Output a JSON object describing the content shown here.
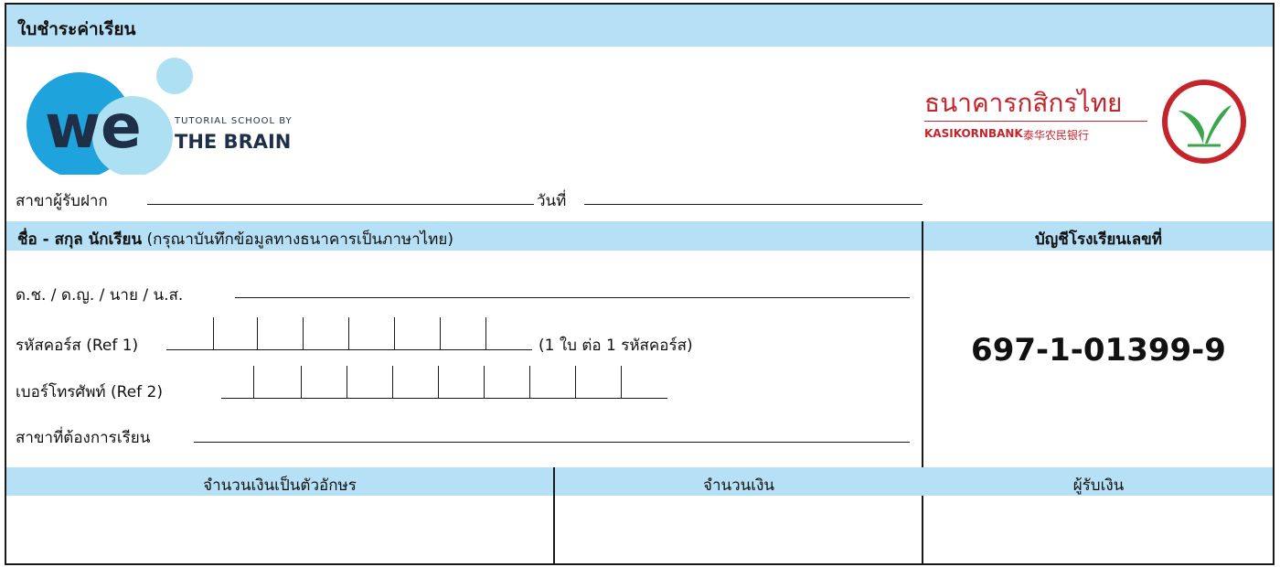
{
  "title": "ใบชำระค่าเรียน",
  "school_logo": {
    "mark": "we",
    "line1": "TUTORIAL SCHOOL BY",
    "line2": "THE BRAIN",
    "colors": {
      "circle_dark": "#1fa3dc",
      "circle_light": "#aee0f4",
      "text_dark": "#1f2f47"
    }
  },
  "bank_logo": {
    "name_thai": "ธนาคารกสิกรไทย",
    "name_en": "KASIKORNBANK",
    "name_cn": "泰华农民银行",
    "colors": {
      "red": "#c5242b",
      "green": "#3aa54a"
    }
  },
  "branch_label": "สาขาผู้รับฝาก",
  "date_label": "วันที่",
  "name_header": {
    "bold": "ชื่อ - สกุล นักเรียน",
    "note": "(กรุณาบันทึกข้อมูลทางธนาคารเป็นภาษาไทย)"
  },
  "account_header": "บัญชีโรงเรียนเลขที่",
  "account_number": "697-1-01399-9",
  "fields": {
    "title_prefix": "ด.ช. / ด.ญ. / นาย / น.ส.",
    "course_code": "รหัสคอร์ส (Ref 1)",
    "course_note": "(1 ใบ ต่อ 1 รหัสคอร์ส)",
    "phone": "เบอร์โทรศัพท์ (Ref 2)",
    "branch": "สาขาที่ต้องการเรียน"
  },
  "bottom_headers": {
    "amount_text": "จำนวนเงินเป็นตัวอักษร",
    "amount": "จำนวนเงิน",
    "receiver": "ผู้รับเงิน"
  },
  "colors": {
    "band": "#b6e0f5",
    "border": "#1a1a1a"
  }
}
